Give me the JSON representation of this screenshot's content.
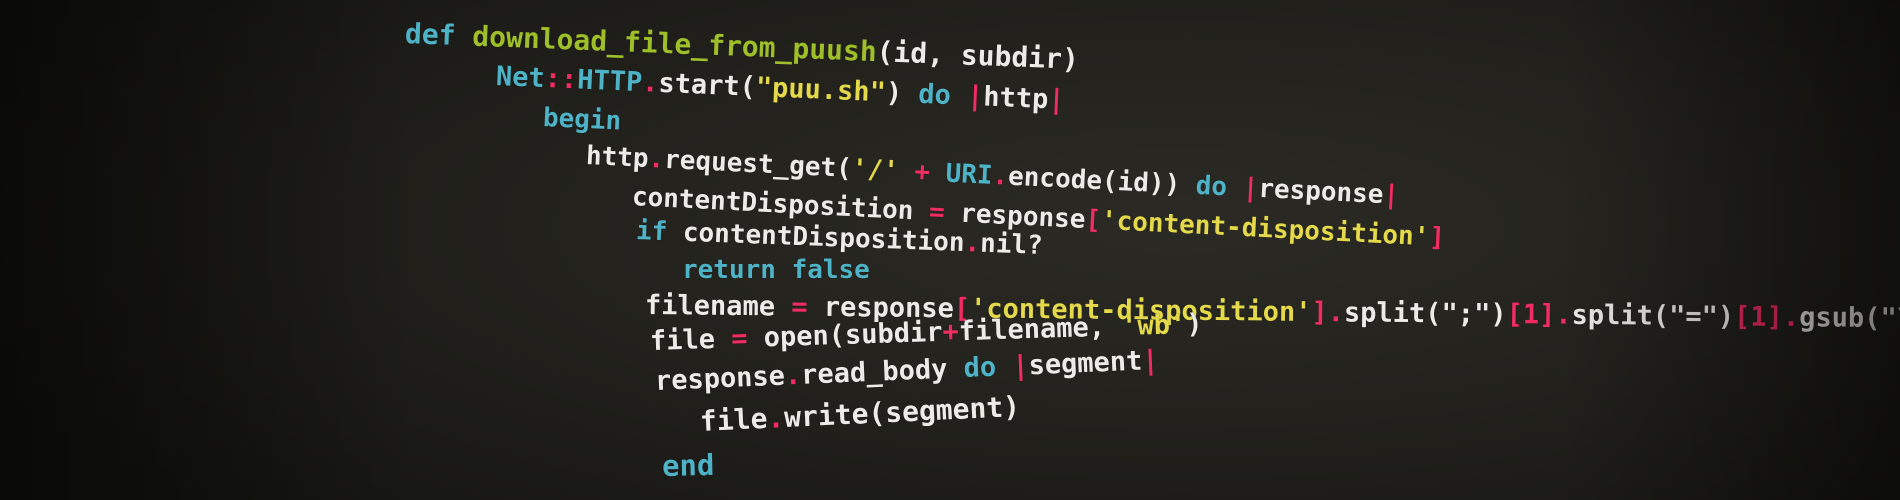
{
  "code": {
    "lines": [
      [
        {
          "t": "def ",
          "c": "kw"
        },
        {
          "t": "download_file_from_puush",
          "c": "fn"
        },
        {
          "t": "(id, subdir)",
          "c": "pl"
        }
      ],
      [
        {
          "t": "Net",
          "c": "kw"
        },
        {
          "t": "::",
          "c": "op"
        },
        {
          "t": "HTTP",
          "c": "kw"
        },
        {
          "t": ".",
          "c": "op"
        },
        {
          "t": "start(",
          "c": "pl"
        },
        {
          "t": "\"puu.sh\"",
          "c": "str"
        },
        {
          "t": ") ",
          "c": "pl"
        },
        {
          "t": "do ",
          "c": "kw"
        },
        {
          "t": "|",
          "c": "op"
        },
        {
          "t": "http",
          "c": "pl"
        },
        {
          "t": "|",
          "c": "op"
        }
      ],
      [
        {
          "t": "begin",
          "c": "kw"
        }
      ],
      [
        {
          "t": "http",
          "c": "pl"
        },
        {
          "t": ".",
          "c": "op"
        },
        {
          "t": "request_get(",
          "c": "pl"
        },
        {
          "t": "'/'",
          "c": "str"
        },
        {
          "t": " + ",
          "c": "op"
        },
        {
          "t": "URI",
          "c": "kw"
        },
        {
          "t": ".",
          "c": "op"
        },
        {
          "t": "encode(id)) ",
          "c": "pl"
        },
        {
          "t": "do ",
          "c": "kw"
        },
        {
          "t": "|",
          "c": "op"
        },
        {
          "t": "response",
          "c": "pl"
        },
        {
          "t": "|",
          "c": "op"
        }
      ],
      [
        {
          "t": "contentDisposition ",
          "c": "pl"
        },
        {
          "t": "= ",
          "c": "op"
        },
        {
          "t": "response",
          "c": "pl"
        },
        {
          "t": "[",
          "c": "op"
        },
        {
          "t": "'content-disposition'",
          "c": "str"
        },
        {
          "t": "]",
          "c": "op"
        }
      ],
      [
        {
          "t": "if ",
          "c": "kw"
        },
        {
          "t": "contentDisposition",
          "c": "pl"
        },
        {
          "t": ".",
          "c": "op"
        },
        {
          "t": "nil?",
          "c": "pl"
        }
      ],
      [
        {
          "t": "return false",
          "c": "kw"
        }
      ],
      [
        {
          "t": "filename ",
          "c": "pl"
        },
        {
          "t": "= ",
          "c": "op"
        },
        {
          "t": "response",
          "c": "pl"
        },
        {
          "t": "[",
          "c": "op"
        },
        {
          "t": "'content-disposition'",
          "c": "str"
        },
        {
          "t": "].",
          "c": "op"
        },
        {
          "t": "split(\";\")",
          "c": "pl"
        },
        {
          "t": "[1].",
          "c": "op"
        },
        {
          "t": "split(\"=\")",
          "c": "pl"
        },
        {
          "t": "[1].",
          "c": "op"
        },
        {
          "t": "gsub(\"\\\"\", \"\")",
          "c": "pl"
        }
      ],
      [
        {
          "t": "file ",
          "c": "pl"
        },
        {
          "t": "= ",
          "c": "op"
        },
        {
          "t": "open(subdir",
          "c": "pl"
        },
        {
          "t": "+",
          "c": "op"
        },
        {
          "t": "filename, ",
          "c": "pl"
        },
        {
          "t": "'wb'",
          "c": "str"
        },
        {
          "t": ")",
          "c": "pl"
        }
      ],
      [
        {
          "t": "response",
          "c": "pl"
        },
        {
          "t": ".",
          "c": "op"
        },
        {
          "t": "read_body ",
          "c": "pl"
        },
        {
          "t": "do ",
          "c": "kw"
        },
        {
          "t": "|",
          "c": "op"
        },
        {
          "t": "segment",
          "c": "pl"
        },
        {
          "t": "|",
          "c": "op"
        }
      ],
      [
        {
          "t": "file",
          "c": "pl"
        },
        {
          "t": ".",
          "c": "op"
        },
        {
          "t": "write(segment)",
          "c": "pl"
        }
      ],
      [
        {
          "t": "end",
          "c": "kw"
        }
      ]
    ]
  }
}
